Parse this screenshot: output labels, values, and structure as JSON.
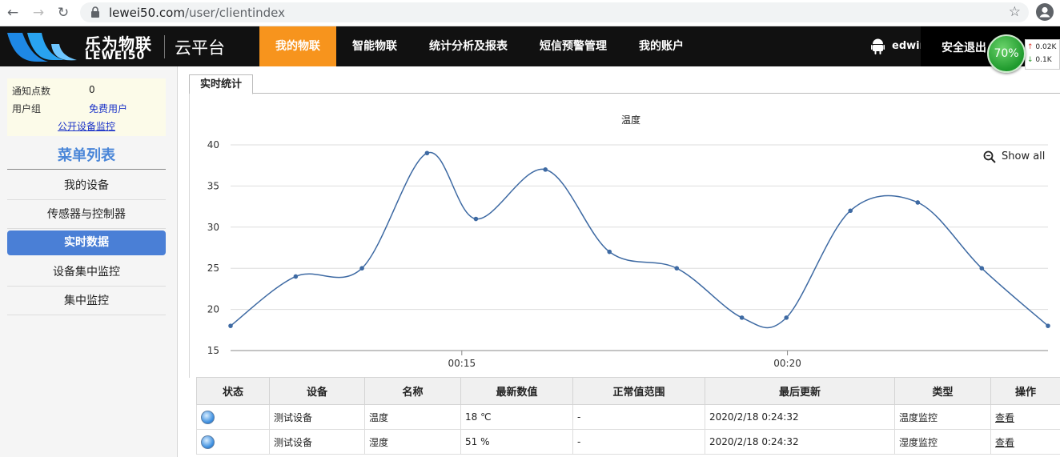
{
  "browser": {
    "url_host": "lewei50.com",
    "url_path": "/user/clientindex"
  },
  "header": {
    "brand_cn": "乐为物联",
    "brand_en": "LEWEI50",
    "platform": "云平台",
    "nav": [
      "我的物联",
      "智能物联",
      "统计分析及报表",
      "短信预警管理",
      "我的账户"
    ],
    "active_nav": "我的物联",
    "username": "edwin",
    "logout": "安全退出"
  },
  "speed_widget": {
    "percent": "70%",
    "up": "0.02K",
    "down": "0.1K"
  },
  "sidebar": {
    "notify_label": "通知点数",
    "notify_value": "0",
    "group_label": "用户组",
    "group_value": "免费用户",
    "public_link": "公开设备监控",
    "menu_title": "菜单列表",
    "menu": [
      "我的设备",
      "传感器与控制器",
      "实时数据",
      "设备集中监控",
      "集中监控"
    ],
    "active_menu": "实时数据"
  },
  "tab": "实时统计",
  "chart_data": {
    "type": "line",
    "title": "温度",
    "show_all": "Show all",
    "ylim": [
      15,
      40
    ],
    "yticks": [
      "15",
      "20",
      "25",
      "30",
      "35",
      "40"
    ],
    "xticks": [
      "00:15",
      "00:20"
    ],
    "series": [
      {
        "x": [
          "00:11:27",
          "00:12:27",
          "00:13:28",
          "00:14:28",
          "00:15:13",
          "00:16:17",
          "00:17:16",
          "00:18:18",
          "00:19:18",
          "00:19:59",
          "00:20:58",
          "00:22:00",
          "00:22:59",
          "00:24:00"
        ],
        "values": [
          18,
          24,
          25,
          39,
          31,
          37,
          27,
          25,
          19,
          19,
          32,
          33,
          25,
          18
        ]
      }
    ],
    "color": "#3e6aa3",
    "grid": true
  },
  "table": {
    "headers": [
      "状态",
      "设备",
      "名称",
      "最新数值",
      "正常值范围",
      "最后更新",
      "类型",
      "操作"
    ],
    "rows": [
      {
        "device": "测试设备",
        "name": "温度",
        "value": "18 ℃",
        "range": "-",
        "updated": "2020/2/18 0:24:32",
        "type": "温度监控",
        "op": "查看"
      },
      {
        "device": "测试设备",
        "name": "湿度",
        "value": "51 %",
        "range": "-",
        "updated": "2020/2/18 0:24:32",
        "type": "湿度监控",
        "op": "查看"
      }
    ]
  }
}
